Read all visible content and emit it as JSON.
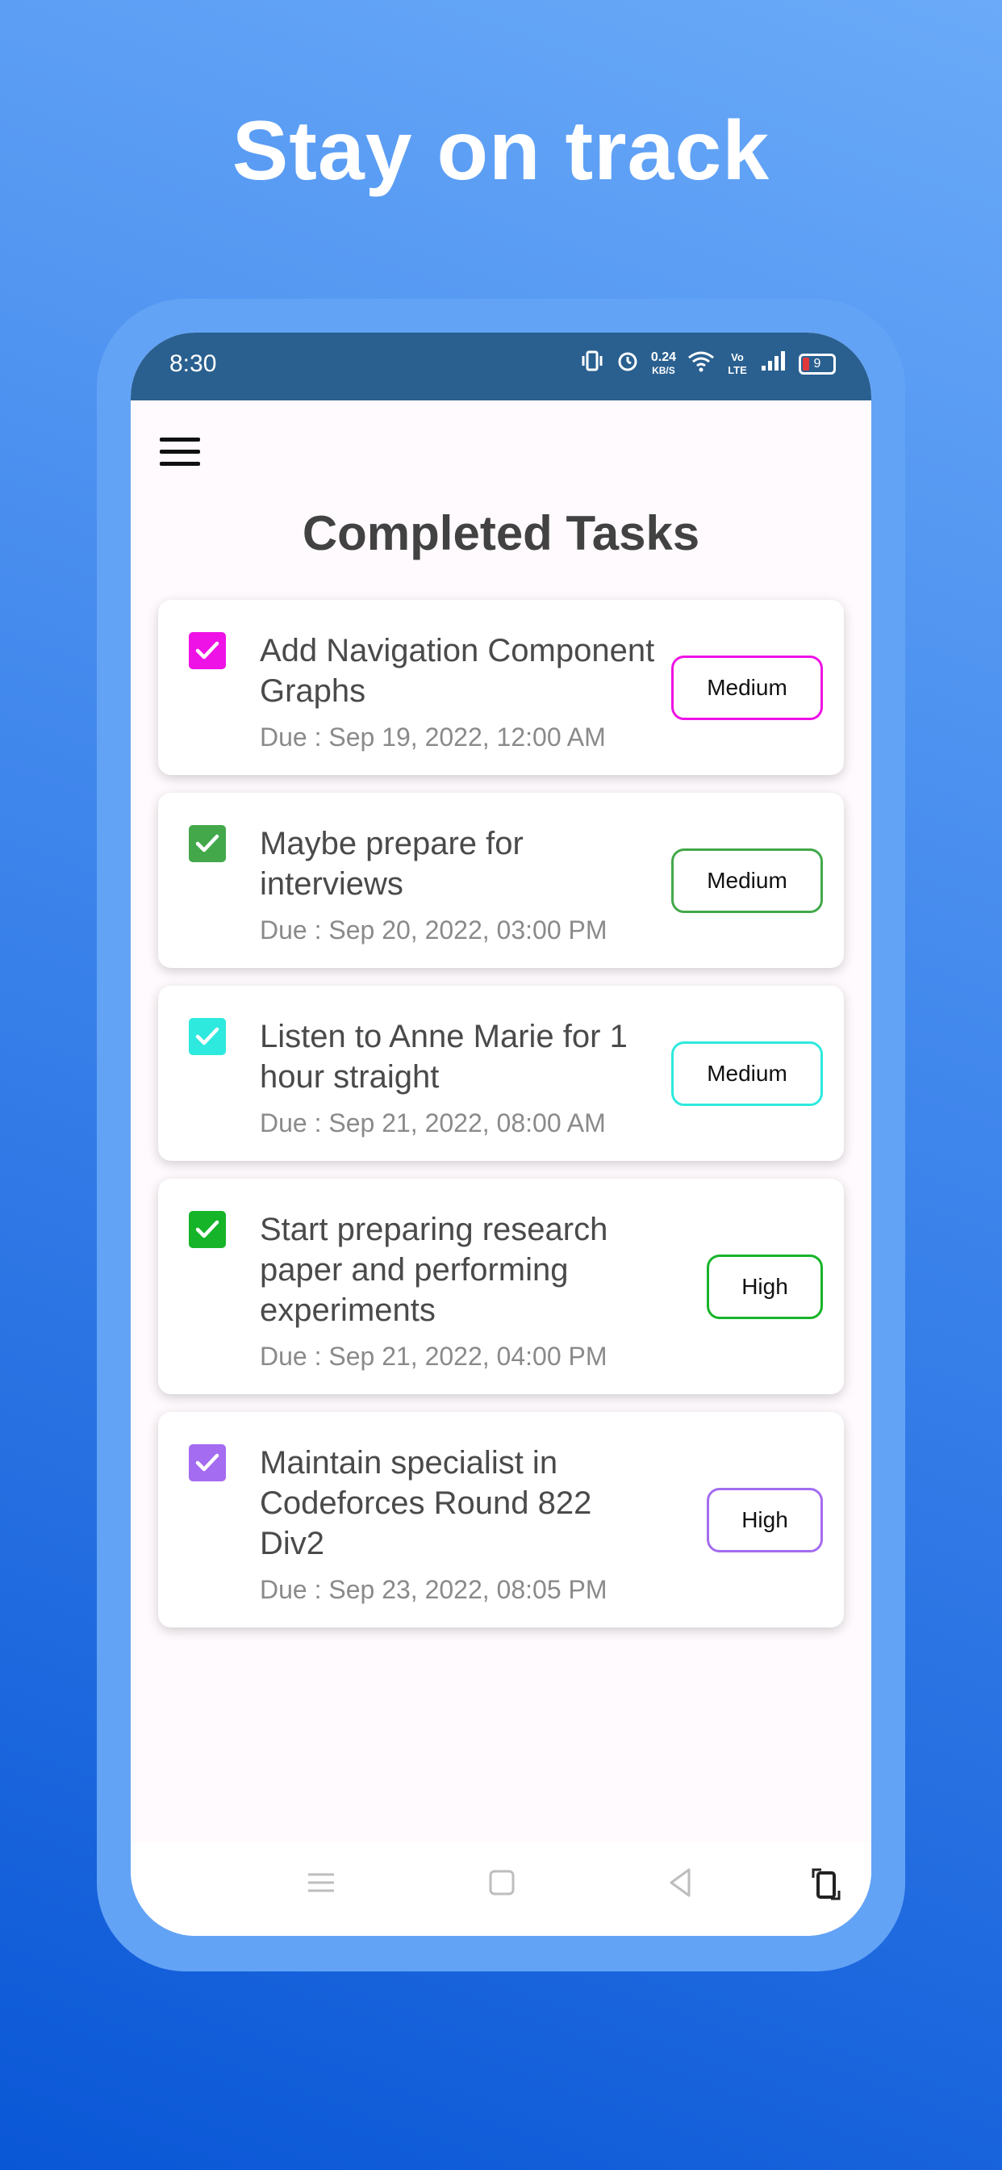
{
  "headline": "Stay on track",
  "status_bar": {
    "time": "8:30",
    "net_speed_top": "0.24",
    "net_speed_bottom": "KB/S",
    "volte_label": "Vo LTE",
    "battery_level": "9"
  },
  "page": {
    "title": "Completed Tasks"
  },
  "tasks": [
    {
      "title": "Add Navigation Component Graphs",
      "due": "Due : Sep 19, 2022, 12:00 AM",
      "priority": "Medium",
      "color": "#ee12e6",
      "checked": true
    },
    {
      "title": "Maybe prepare for interviews",
      "due": "Due : Sep 20, 2022, 03:00 PM",
      "priority": "Medium",
      "color": "#43a84a",
      "checked": true
    },
    {
      "title": "Listen to Anne Marie for 1 hour straight",
      "due": "Due : Sep 21, 2022, 08:00 AM",
      "priority": "Medium",
      "color": "#2ee9de",
      "checked": true
    },
    {
      "title": "Start preparing research paper and performing experiments",
      "due": "Due : Sep 21, 2022, 04:00 PM",
      "priority": "High",
      "color": "#16b428",
      "checked": true
    },
    {
      "title": "Maintain specialist in Codeforces Round 822 Div2",
      "due": "Due : Sep 23, 2022, 08:05 PM",
      "priority": "High",
      "color": "#a46cf0",
      "checked": true
    }
  ],
  "icons": {
    "menu": "hamburger-menu-icon",
    "nav_recents": "recents-icon",
    "nav_home": "home-icon",
    "nav_back": "back-icon",
    "nav_rotate": "rotate-icon"
  }
}
